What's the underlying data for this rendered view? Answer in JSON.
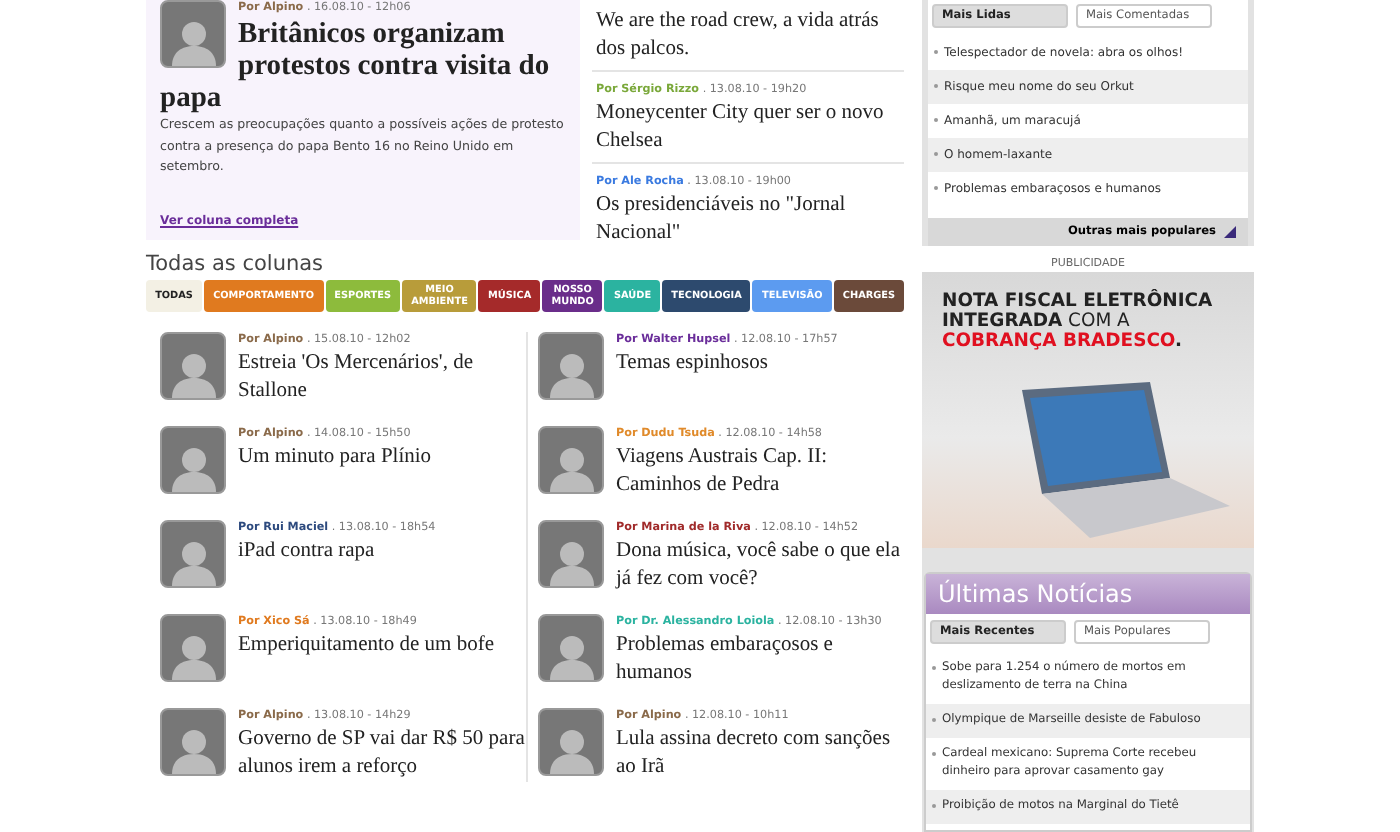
{
  "featured": {
    "author": "Por Alpino",
    "date": ". 16.08.10 - 12h06",
    "headline": "Britânicos organizam protestos contra visita do papa",
    "summary": "Crescem as preocupações quanto a possíveis ações de protesto contra a presença do papa Bento 16 no Reino Unido em setembro.",
    "link": "Ver coluna completa"
  },
  "top_list": [
    {
      "headline": "We are the road crew, a vida atrás dos palcos."
    },
    {
      "author": "Por Sérgio Rizzo",
      "color": "#7aa83a",
      "date": ". 13.08.10 - 19h20",
      "headline": "Moneycenter City quer ser o novo Chelsea"
    },
    {
      "author": "Por Ale Rocha",
      "color": "#3a7ae0",
      "date": ". 13.08.10 - 19h00",
      "headline": "Os presidenciáveis no \"Jornal Nacional\""
    }
  ],
  "all_columns": {
    "title": "Todas as colunas",
    "tabs": [
      {
        "label": "TODAS",
        "selected": true,
        "color": "#f3f0e4"
      },
      {
        "label": "COMPORTAMENTO",
        "selected": false,
        "color": "#e07a1f"
      },
      {
        "label": "ESPORTES",
        "selected": false,
        "color": "#8dbb3c"
      },
      {
        "label": "MEIO AMBIENTE",
        "selected": false,
        "color": "#b89c3a"
      },
      {
        "label": "MÚSICA",
        "selected": false,
        "color": "#a52a2a"
      },
      {
        "label": "NOSSO MUNDO",
        "selected": false,
        "color": "#6a2d8a"
      },
      {
        "label": "SAÚDE",
        "selected": false,
        "color": "#2bb3a0"
      },
      {
        "label": "TECNOLOGIA",
        "selected": false,
        "color": "#2d4a6e"
      },
      {
        "label": "TELEVISÃO",
        "selected": false,
        "color": "#5c9bf0"
      },
      {
        "label": "CHARGES",
        "selected": false,
        "color": "#6b4a3a"
      }
    ],
    "columns": [
      {
        "posts": [
          {
            "author": "Por Alpino",
            "color": "#8a6a4a",
            "date": ". 15.08.10 - 12h02",
            "headline": "Estreia 'Os Mercenários', de Stallone"
          },
          {
            "author": "Por Alpino",
            "color": "#8a6a4a",
            "date": ". 14.08.10 - 15h50",
            "headline": "Um minuto para Plínio"
          },
          {
            "author": "Por Rui Maciel",
            "color": "#2d4a7e",
            "date": ". 13.08.10 - 18h54",
            "headline": "iPad contra rapa"
          },
          {
            "author": "Por Xico Sá",
            "color": "#e07a1f",
            "date": ". 13.08.10 - 18h49",
            "headline": "Emperiquitamento de um bofe"
          },
          {
            "author": "Por Alpino",
            "color": "#8a6a4a",
            "date": ". 13.08.10 - 14h29",
            "headline": "Governo de SP vai dar R$ 50 para alunos irem a reforço"
          }
        ]
      },
      {
        "posts": [
          {
            "author": "Por Walter Hupsel",
            "color": "#6a2d9a",
            "date": ". 12.08.10 - 17h57",
            "headline": "Temas espinhosos"
          },
          {
            "author": "Por Dudu Tsuda",
            "color": "#e08a2a",
            "date": ". 12.08.10 - 14h58",
            "headline": "Viagens Austrais Cap. II: Caminhos de Pedra"
          },
          {
            "author": "Por Marina de la Riva",
            "color": "#a02a2a",
            "date": ". 12.08.10 - 14h52",
            "headline": "Dona música, você sabe o que ela já fez com você?"
          },
          {
            "author": "Por Dr. Alessandro Loiola",
            "color": "#2bb3a0",
            "date": ". 12.08.10 - 13h30",
            "headline": "Problemas embaraçosos e humanos"
          },
          {
            "author": "Por Alpino",
            "color": "#8a6a4a",
            "date": ". 12.08.10 - 10h11",
            "headline": "Lula assina decreto com sanções ao Irã"
          }
        ]
      }
    ]
  },
  "most_popular": {
    "tabs": [
      {
        "label": "Mais Lidas",
        "selected": true
      },
      {
        "label": "Mais Comentadas",
        "selected": false
      }
    ],
    "items": [
      "Telespectador de novela: abra os olhos!",
      "Risque meu nome do seu Orkut",
      "Amanhã, um maracujá",
      "O homem-laxante",
      "Problemas embaraçosos e humanos"
    ],
    "more_link": "Outras mais populares"
  },
  "ad": {
    "label": "PUBLICIDADE",
    "headline": [
      {
        "kind": "strong",
        "text": "NOTA FISCAL ELETRÔNICA"
      },
      {
        "kind": "strong",
        "text": "INTEGRADA"
      },
      {
        "kind": "plain",
        "text": "COM A"
      },
      {
        "kind": "accent",
        "text": "COBRANÇA BRADESCO"
      },
      {
        "kind": "strong",
        "text": "."
      }
    ]
  },
  "latest_news": {
    "title": "Últimas Notícias",
    "tabs": [
      {
        "label": "Mais Recentes",
        "selected": true
      },
      {
        "label": "Mais Populares",
        "selected": false
      }
    ],
    "items": [
      "Sobe para 1.254 o número de mortos em deslizamento de terra na China",
      "Olympique de Marseille desiste de Fabuloso",
      "Cardeal mexicano: Suprema Corte recebeu dinheiro para aprovar casamento gay",
      "Proibição de motos na Marginal do Tietê"
    ]
  }
}
